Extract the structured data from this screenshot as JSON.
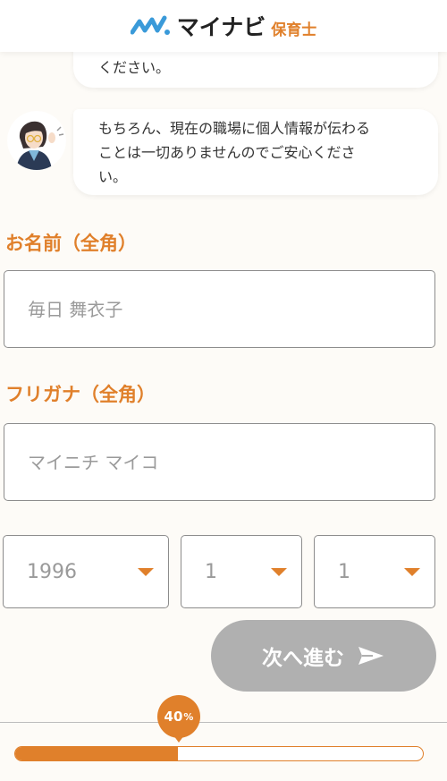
{
  "header": {
    "logo_main": "マイナビ",
    "logo_sub": "保育士",
    "logo_color": "#3a9ad9"
  },
  "chat": {
    "message_1": "ください。",
    "message_2_line_1": "もちろん、現在の職場に個人情報が伝わる",
    "message_2_line_2": "ことは一切ありませんのでご安心くださ",
    "message_2_line_3": "い。"
  },
  "form": {
    "name_label": "お名前（全角）",
    "name_placeholder": "毎日 舞衣子",
    "kana_label": "フリガナ（全角）",
    "kana_placeholder": "マイニチ マイコ",
    "birth_year": "1996",
    "birth_month": "1",
    "birth_day": "1"
  },
  "next_button": {
    "label": "次へ進む",
    "icon": "send-icon"
  },
  "progress": {
    "value": 40,
    "number_text": "40",
    "unit_text": "%"
  },
  "colors": {
    "accent": "#e0802b",
    "disabled_button": "#b0b0b0",
    "background": "#fdfbf7"
  }
}
